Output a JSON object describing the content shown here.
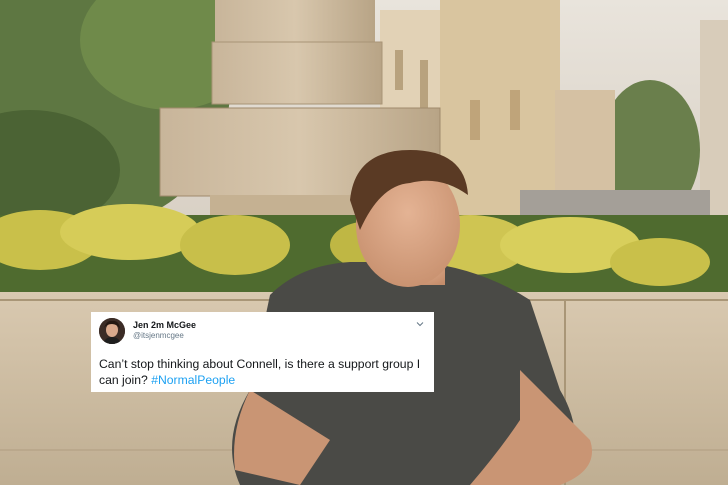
{
  "tweet": {
    "display_name": "Jen 2m McGee",
    "handle": "@itsjenmcgee",
    "text": "Can’t stop thinking about Connell, is there a support group I can join?",
    "hashtag": "#NormalPeople"
  },
  "icons": {
    "avatar": "profile-photo",
    "menu": "chevron-down-icon"
  },
  "colors": {
    "card_background": "#ffffff",
    "text": "#14171a",
    "secondary_text": "#657786",
    "hashtag": "#1da1f2"
  }
}
